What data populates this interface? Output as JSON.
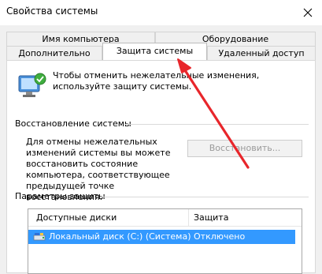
{
  "window": {
    "title": "Свойства системы"
  },
  "tabs": {
    "row1": [
      "Имя компьютера",
      "Оборудование"
    ],
    "row2": [
      "Дополнительно",
      "Защита системы",
      "Удаленный доступ"
    ],
    "active": "Защита системы"
  },
  "intro": {
    "text": "Чтобы отменить нежелательные изменения, используйте защиту системы."
  },
  "restore": {
    "heading": "Восстановление системы",
    "description": "Для отмены нежелательных изменений системы вы можете восстановить состояние компьютера, соответствующее предыдущей точке восстановления.",
    "button_label": "Восстановить..."
  },
  "protection": {
    "heading": "Параметры защиты",
    "columns": [
      "Доступные диски",
      "Защита"
    ],
    "rows": [
      {
        "drive": "Локальный диск (C:) (Система)",
        "status": "Отключено"
      }
    ]
  },
  "colors": {
    "selection": "#3399ff",
    "arrow": "#e8262b"
  },
  "icons": [
    "close-icon",
    "shield-icon",
    "drive-icon"
  ]
}
